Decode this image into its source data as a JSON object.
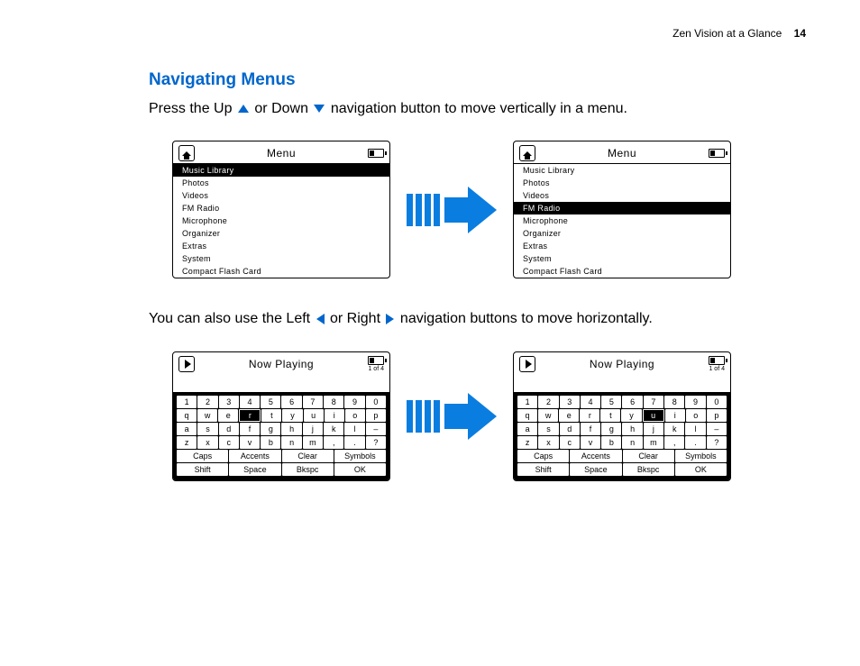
{
  "header": {
    "section": "Zen Vision at a Glance",
    "page_number": "14"
  },
  "heading": "Navigating Menus",
  "text1_a": "Press the Up ",
  "text1_b": " or Down ",
  "text1_c": " navigation button to move vertically in a menu.",
  "text2_a": "You can also use the Left ",
  "text2_b": " or Right ",
  "text2_c": " navigation buttons to move horizontally.",
  "menu_title": "Menu",
  "now_playing_title": "Now Playing",
  "pager": "1 of 4",
  "menu_items": [
    "Music Library",
    "Photos",
    "Videos",
    "FM Radio",
    "Microphone",
    "Organizer",
    "Extras",
    "System",
    "Compact Flash Card"
  ],
  "menu_selected_left": 0,
  "menu_selected_right": 3,
  "kb_rows": [
    [
      "1",
      "2",
      "3",
      "4",
      "5",
      "6",
      "7",
      "8",
      "9",
      "0"
    ],
    [
      "q",
      "w",
      "e",
      "r",
      "t",
      "y",
      "u",
      "i",
      "o",
      "p"
    ],
    [
      "a",
      "s",
      "d",
      "f",
      "g",
      "h",
      "j",
      "k",
      "l",
      "–"
    ],
    [
      "z",
      "x",
      "c",
      "v",
      "b",
      "n",
      "m",
      ",",
      ".",
      "?"
    ]
  ],
  "kb_func1": [
    "Caps",
    "Accents",
    "Clear",
    "Symbols"
  ],
  "kb_func2": [
    "Shift",
    "Space",
    "Bkspc",
    "OK"
  ],
  "kb_selected_left": [
    1,
    3
  ],
  "kb_selected_right": [
    1,
    6
  ]
}
